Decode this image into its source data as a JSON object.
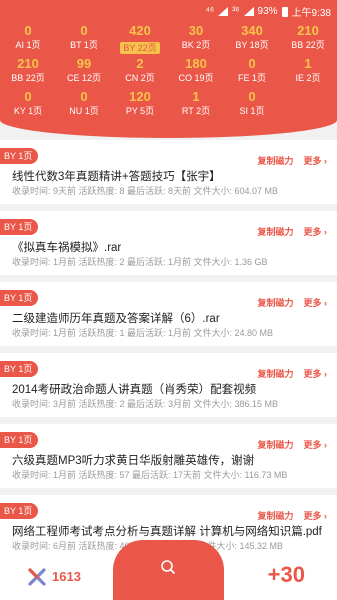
{
  "status_bar": {
    "network": "⁴⁶",
    "signal2": "³⁶",
    "battery": "93%",
    "time": "上午9:38"
  },
  "categories": [
    [
      {
        "count": "0",
        "label": "AI 1页"
      },
      {
        "count": "0",
        "label": "BT 1页"
      },
      {
        "count": "420",
        "label": "BY 22页",
        "selected": true
      },
      {
        "count": "30",
        "label": "BK 2页"
      },
      {
        "count": "340",
        "label": "BY 18页"
      },
      {
        "count": "210",
        "label": "BB 22页"
      }
    ],
    [
      {
        "count": "210",
        "label": "BB 22页"
      },
      {
        "count": "99",
        "label": "CE 12页"
      },
      {
        "count": "2",
        "label": "CN 2页"
      },
      {
        "count": "180",
        "label": "CO 19页"
      },
      {
        "count": "0",
        "label": "FE 1页"
      },
      {
        "count": "1",
        "label": "IE 2页"
      }
    ],
    [
      {
        "count": "0",
        "label": "KY 1页"
      },
      {
        "count": "0",
        "label": "NU 1页"
      },
      {
        "count": "120",
        "label": "PY 5页"
      },
      {
        "count": "1",
        "label": "RT 2页"
      },
      {
        "count": "0",
        "label": "SI 1页"
      }
    ]
  ],
  "action_copy": "复制磁力",
  "action_more": "更多 ›",
  "items": [
    {
      "badge": "BY 1页",
      "title": "线性代数3年真题精讲+答题技巧【张宇】",
      "meta": "收录时间:  9天前  活跃热度:  8  最后活跃:  8天前  文件大小:  604.07 MB"
    },
    {
      "badge": "BY 1页",
      "title": "《拟真车祸模拟》.rar",
      "meta": "收录时间:  1月前  活跃热度:  2  最后活跃:  1月前  文件大小:  1.36 GB"
    },
    {
      "badge": "BY 1页",
      "title": "二级建造师历年真题及答案详解（6）.rar",
      "meta": "收录时间:  1月前  活跃热度:  1  最后活跃:  1月前  文件大小:  24.80 MB"
    },
    {
      "badge": "BY 1页",
      "title": "2014考研政治命题人讲真题（肖秀荣）配套视频",
      "meta": "收录时间:  3月前  活跃热度:  2  最后活跃:  3月前  文件大小:  386.15 MB"
    },
    {
      "badge": "BY 1页",
      "title": "六级真题MP3听力求黄日华版射雕英雄传，谢谢",
      "meta": "收录时间:  1月前  活跃热度:  57  最后活跃:  17天前  文件大小:  116.73 MB"
    },
    {
      "badge": "BY 1页",
      "title": "网络工程师考试考点分析与真题详解 计算机与网络知识篇.pdf",
      "meta": "收录时间:  6月前  活跃热度:  46  最后活跃:  3月前  文件大小:  145.32 MB"
    }
  ],
  "bottom": {
    "count": "1613",
    "plus": "+30"
  },
  "colors": {
    "accent": "#ea5749",
    "highlight": "#f6c34a"
  }
}
